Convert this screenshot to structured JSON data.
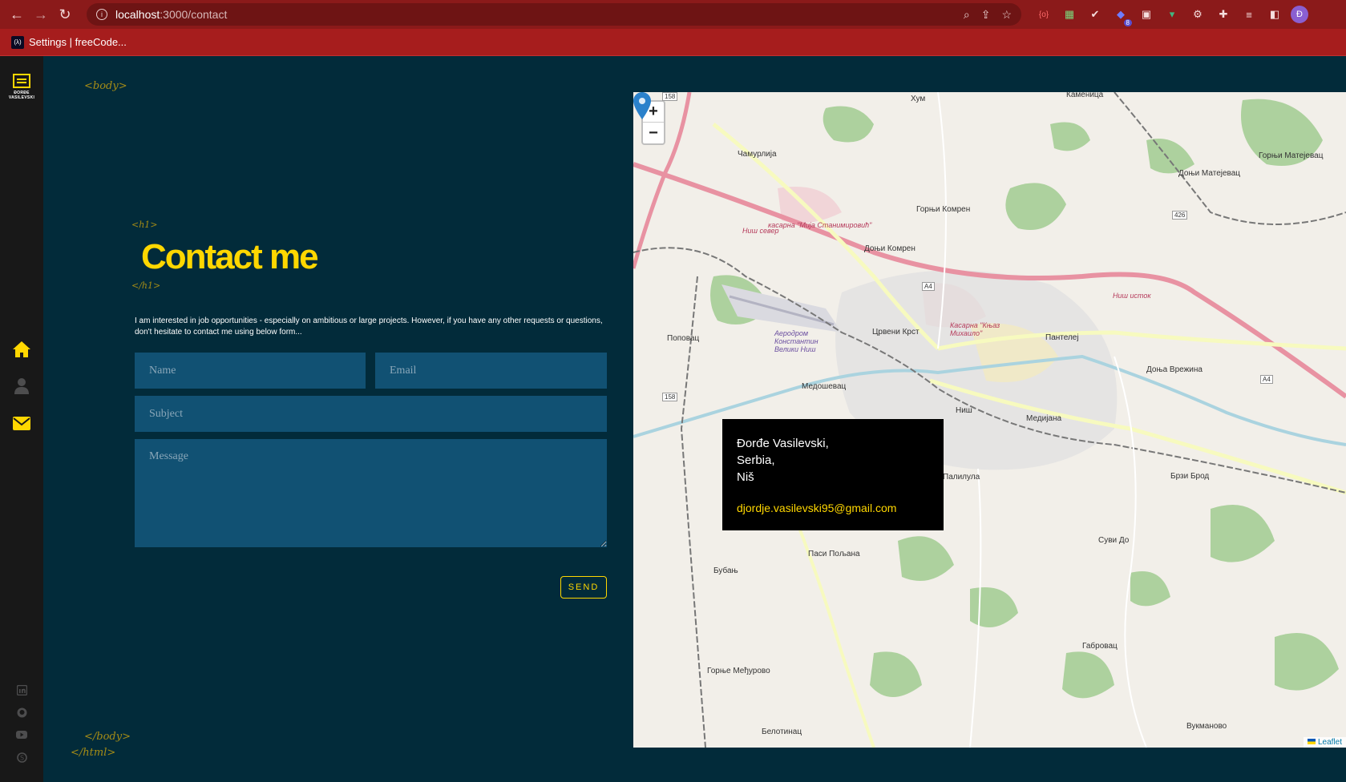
{
  "browser": {
    "url_host": "localhost",
    "url_path": ":3000/contact",
    "bookmark_label": "Settings | freeCode...",
    "profile_initial": "Đ",
    "extension_badge": "8"
  },
  "sidebar": {
    "logo_line1": "ĐORĐE",
    "logo_line2": "VASILEVSKI"
  },
  "tags": {
    "body_open": "<body>",
    "h1_open": "<h1>",
    "h1_close": "</h1>",
    "body_close": "</body>",
    "html_close": "</html>"
  },
  "contact": {
    "title": "Contact me",
    "intro": "I am interested in job opportunities - especially on ambitious or large projects. However, if you have any other requests or questions, don't hesitate to contact me using below form...",
    "name_placeholder": "Name",
    "email_placeholder": "Email",
    "subject_placeholder": "Subject",
    "message_placeholder": "Message",
    "send_label": "SEND"
  },
  "map": {
    "zoom_in": "+",
    "zoom_out": "−",
    "attribution": "Leaflet",
    "places": {
      "hum": "Хум",
      "camurlija": "Чамурлија",
      "gornji_komren": "Горњи Комрен",
      "donji_komren": "Доњи Комрен",
      "crveni_krst": "Црвени Крст",
      "pantelej": "Пантелеј",
      "popovac": "Поповац",
      "medosevac": "Медошевац",
      "nis": "Ниш",
      "medijana": "Медијана",
      "palilula": "Палилула",
      "donja_vrezina": "Доња Врежина",
      "brzi_brod": "Брзи Брод",
      "suvi_do": "Суви До",
      "pasi_poljana": "Паси Пољана",
      "bubanj": "Бубањ",
      "gabrovac": "Габровац",
      "gornje_medjurovo": "Горње Међурово",
      "belotinac": "Белотинац",
      "vuknavo": "Вукманово",
      "donji_matejevac": "Доњи Матејевац",
      "gornji_matejevac": "Горњи Матејевац",
      "kamenica": "Каменица",
      "airport": "Аеродром Константин Велики Ниш",
      "kasarna_mija": "касарна \"Мија Станимировић\"",
      "kasarna_knjaz": "Касарна \"Књаз Михаило\"",
      "nis_sever": "Ниш север",
      "nis_istok": "Ниш исток",
      "road_158": "158",
      "road_a4": "A4",
      "road_426": "426"
    }
  },
  "popup": {
    "line1": "Đorđe Vasilevski,",
    "line2": "Serbia,",
    "line3": "Niš",
    "email": "djordje.vasilevski95@gmail.com"
  }
}
